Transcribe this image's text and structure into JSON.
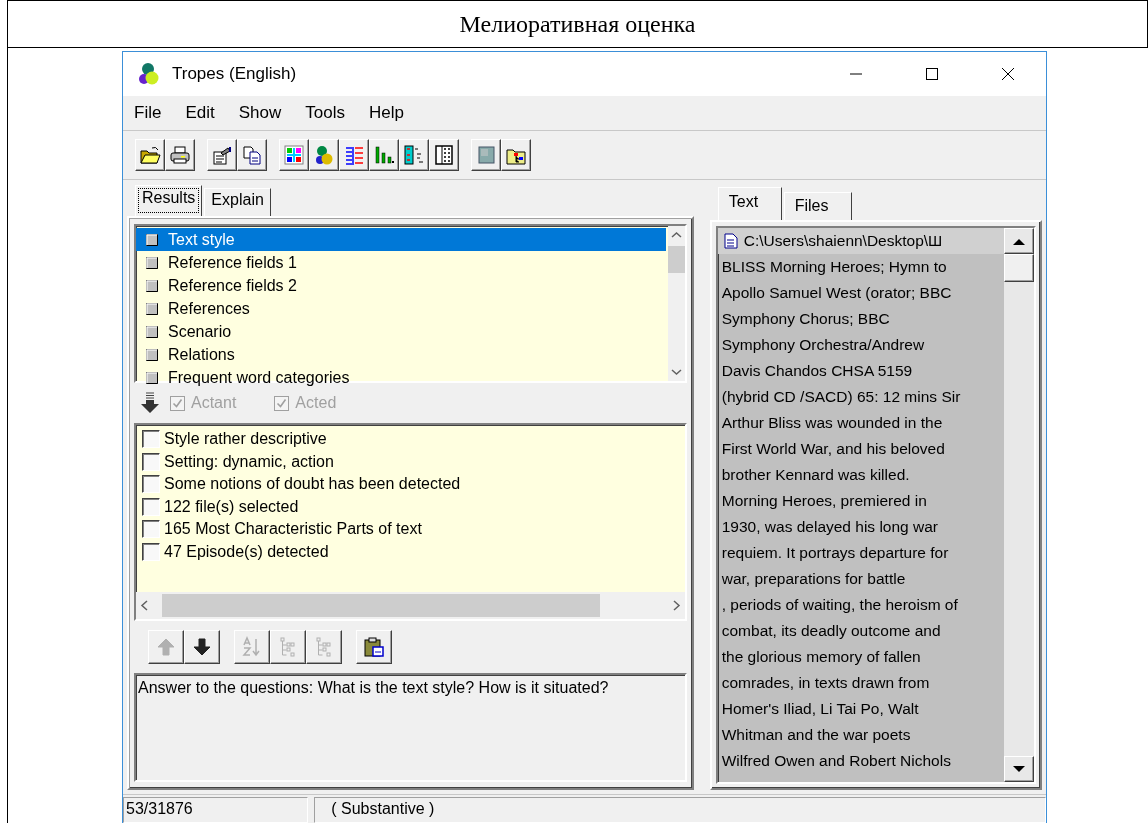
{
  "document": {
    "heading": "Мелиоративная оценка"
  },
  "window": {
    "title": "Tropes (English)"
  },
  "menu": [
    "File",
    "Edit",
    "Show",
    "Tools",
    "Help"
  ],
  "results_pane": {
    "tabs": [
      {
        "label": "Results",
        "selected": true
      },
      {
        "label": "Explain",
        "selected": false
      }
    ],
    "categories": [
      {
        "label": "Text style",
        "selected": true
      },
      {
        "label": "Reference fields 1",
        "selected": false
      },
      {
        "label": "Reference fields 2",
        "selected": false
      },
      {
        "label": "References",
        "selected": false
      },
      {
        "label": "Scenario",
        "selected": false
      },
      {
        "label": "Relations",
        "selected": false
      },
      {
        "label": "Frequent word categories",
        "selected": false
      }
    ],
    "options": [
      {
        "label": "Actant",
        "checked": true,
        "disabled": true
      },
      {
        "label": "Acted",
        "checked": true,
        "disabled": true
      }
    ],
    "results": [
      {
        "label": "Style rather descriptive",
        "checked": false
      },
      {
        "label": "Setting: dynamic, action",
        "checked": false
      },
      {
        "label": "Some notions of doubt has been detected",
        "checked": false
      },
      {
        "label": "122 file(s) selected",
        "checked": false
      },
      {
        "label": "165 Most Characteristic Parts of text",
        "checked": false
      },
      {
        "label": "47 Episode(s) detected",
        "checked": false
      }
    ],
    "tools": [
      {
        "kind": "up",
        "disabled": true
      },
      {
        "kind": "down",
        "disabled": false
      },
      {
        "kind": "sort",
        "disabled": true
      },
      {
        "kind": "tree",
        "disabled": true
      },
      {
        "kind": "tree",
        "disabled": true
      },
      {
        "kind": "paste",
        "disabled": false
      }
    ],
    "explanation": "Answer to the questions: What is the text style? How is it situated?"
  },
  "text_pane": {
    "tabs": [
      {
        "label": "Text",
        "selected": true
      },
      {
        "label": "Files",
        "selected": false
      }
    ],
    "path": "C:\\Users\\shaienn\\Desktop\\Ш",
    "lines": [
      "BLISS Morning Heroes; Hymn to",
      "Apollo Samuel West (orator; BBC",
      "Symphony Chorus; BBC",
      "Symphony Orchestra/Andrew",
      "Davis Chandos CHSA 5159",
      "(hybrid CD /SACD) 65: 12 mins Sir",
      "Arthur Bliss was wounded in the",
      "First World War,  and his beloved",
      "brother Kennard was killed.",
      "Morning Heroes, premiered in",
      "1930,  was delayed his long war",
      "requiem. It portrays departure for",
      "war, preparations for battle",
      ", periods of waiting, the heroism of",
      "combat, its deadly outcome and",
      "the glorious memory of fallen",
      "comrades,  in texts drawn from",
      "Homer's Iliad, Li Tai Po, Walt",
      "Whitman and the war poets",
      "Wilfred Owen and Robert Nichols"
    ]
  },
  "status_bar": [
    "53/31876",
    "( Substantive )"
  ]
}
